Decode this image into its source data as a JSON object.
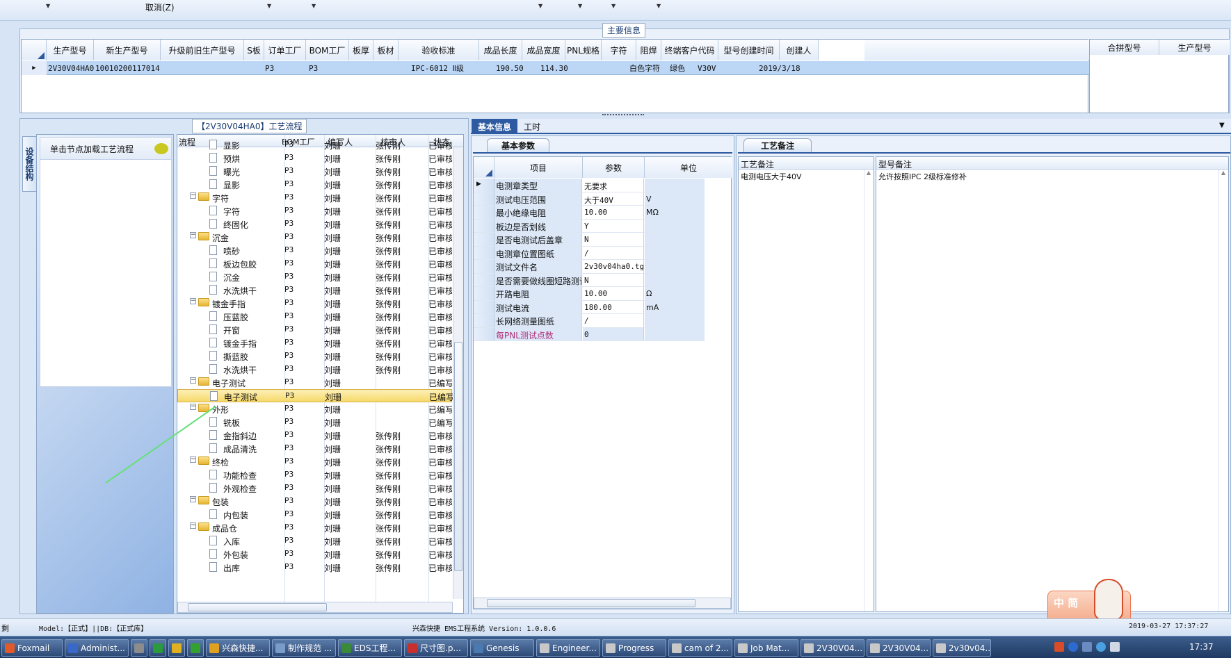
{
  "toolbar": {
    "cancel_label": "取消(Z)"
  },
  "main_info": {
    "group_title": "主要信息",
    "columns": [
      "生产型号",
      "新生产型号",
      "升级前旧生产型号",
      "S板",
      "订单工厂",
      "BOM工厂",
      "板厚",
      "板材",
      "验收标准",
      "成品长度",
      "成品宽度",
      "PNL规格",
      "字符",
      "阻焊",
      "终端客户代码",
      "型号创建时间",
      "创建人"
    ],
    "row": {
      "prod_no": "2V30V04HA0",
      "new_prod_no": "10010200117014",
      "order_factory": "P3",
      "bom_factory": "P3",
      "standard": "IPC-6012 Ⅱ级",
      "length": "190.50",
      "width": "114.30",
      "char": "白色字符",
      "solder_mask": "绿色",
      "customer_code": "V30V",
      "created": "2019/3/18"
    },
    "right_columns": [
      "合拼型号",
      "生产型号"
    ]
  },
  "flow": {
    "group_title": "【2V30V04HA0】工艺流程",
    "side_tab": "设备结构",
    "load_hint": "单击节点加载工艺流程",
    "columns": [
      "流程",
      "BOM工厂",
      "编写人",
      "核审人",
      "状态"
    ],
    "rows": [
      {
        "level": 2,
        "type": "doc",
        "name": "显影",
        "bom": "P3",
        "writer": "刘珊",
        "reviewer": "张传刚",
        "status": "已审核"
      },
      {
        "level": 2,
        "type": "doc",
        "name": "预烘",
        "bom": "P3",
        "writer": "刘珊",
        "reviewer": "张传刚",
        "status": "已审核"
      },
      {
        "level": 2,
        "type": "doc",
        "name": "曝光",
        "bom": "P3",
        "writer": "刘珊",
        "reviewer": "张传刚",
        "status": "已审核"
      },
      {
        "level": 2,
        "type": "doc",
        "name": "显影",
        "bom": "P3",
        "writer": "刘珊",
        "reviewer": "张传刚",
        "status": "已审核"
      },
      {
        "level": 1,
        "type": "folder",
        "name": "字符",
        "bom": "P3",
        "writer": "刘珊",
        "reviewer": "张传刚",
        "status": "已审核"
      },
      {
        "level": 2,
        "type": "doc",
        "name": "字符",
        "bom": "P3",
        "writer": "刘珊",
        "reviewer": "张传刚",
        "status": "已审核"
      },
      {
        "level": 2,
        "type": "doc",
        "name": "终固化",
        "bom": "P3",
        "writer": "刘珊",
        "reviewer": "张传刚",
        "status": "已审核"
      },
      {
        "level": 1,
        "type": "folder",
        "name": "沉金",
        "bom": "P3",
        "writer": "刘珊",
        "reviewer": "张传刚",
        "status": "已审核"
      },
      {
        "level": 2,
        "type": "doc",
        "name": "喷砂",
        "bom": "P3",
        "writer": "刘珊",
        "reviewer": "张传刚",
        "status": "已审核"
      },
      {
        "level": 2,
        "type": "doc",
        "name": "板边包胶",
        "bom": "P3",
        "writer": "刘珊",
        "reviewer": "张传刚",
        "status": "已审核"
      },
      {
        "level": 2,
        "type": "doc",
        "name": "沉金",
        "bom": "P3",
        "writer": "刘珊",
        "reviewer": "张传刚",
        "status": "已审核"
      },
      {
        "level": 2,
        "type": "doc",
        "name": "水洗烘干",
        "bom": "P3",
        "writer": "刘珊",
        "reviewer": "张传刚",
        "status": "已审核"
      },
      {
        "level": 1,
        "type": "folder",
        "name": "镀金手指",
        "bom": "P3",
        "writer": "刘珊",
        "reviewer": "张传刚",
        "status": "已审核"
      },
      {
        "level": 2,
        "type": "doc",
        "name": "压蓝胶",
        "bom": "P3",
        "writer": "刘珊",
        "reviewer": "张传刚",
        "status": "已审核"
      },
      {
        "level": 2,
        "type": "doc",
        "name": "开窗",
        "bom": "P3",
        "writer": "刘珊",
        "reviewer": "张传刚",
        "status": "已审核"
      },
      {
        "level": 2,
        "type": "doc",
        "name": "镀金手指",
        "bom": "P3",
        "writer": "刘珊",
        "reviewer": "张传刚",
        "status": "已审核"
      },
      {
        "level": 2,
        "type": "doc",
        "name": "撕蓝胶",
        "bom": "P3",
        "writer": "刘珊",
        "reviewer": "张传刚",
        "status": "已审核"
      },
      {
        "level": 2,
        "type": "doc",
        "name": "水洗烘干",
        "bom": "P3",
        "writer": "刘珊",
        "reviewer": "张传刚",
        "status": "已审核"
      },
      {
        "level": 1,
        "type": "folder",
        "name": "电子测试",
        "bom": "P3",
        "writer": "刘珊",
        "reviewer": "",
        "status": "已编写"
      },
      {
        "level": 2,
        "type": "doc",
        "name": "电子测试",
        "bom": "P3",
        "writer": "刘珊",
        "reviewer": "",
        "status": "已编写",
        "selected": true
      },
      {
        "level": 1,
        "type": "folder",
        "name": "外形",
        "bom": "P3",
        "writer": "刘珊",
        "reviewer": "",
        "status": "已编写"
      },
      {
        "level": 2,
        "type": "doc",
        "name": "铣板",
        "bom": "P3",
        "writer": "刘珊",
        "reviewer": "",
        "status": "已编写"
      },
      {
        "level": 2,
        "type": "doc",
        "name": "金指斜边",
        "bom": "P3",
        "writer": "刘珊",
        "reviewer": "张传刚",
        "status": "已审核"
      },
      {
        "level": 2,
        "type": "doc",
        "name": "成品清洗",
        "bom": "P3",
        "writer": "刘珊",
        "reviewer": "张传刚",
        "status": "已审核"
      },
      {
        "level": 1,
        "type": "folder",
        "name": "终检",
        "bom": "P3",
        "writer": "刘珊",
        "reviewer": "张传刚",
        "status": "已审核"
      },
      {
        "level": 2,
        "type": "doc",
        "name": "功能检查",
        "bom": "P3",
        "writer": "刘珊",
        "reviewer": "张传刚",
        "status": "已审核"
      },
      {
        "level": 2,
        "type": "doc",
        "name": "外观检查",
        "bom": "P3",
        "writer": "刘珊",
        "reviewer": "张传刚",
        "status": "已审核"
      },
      {
        "level": 1,
        "type": "folder",
        "name": "包装",
        "bom": "P3",
        "writer": "刘珊",
        "reviewer": "张传刚",
        "status": "已审核"
      },
      {
        "level": 2,
        "type": "doc",
        "name": "内包装",
        "bom": "P3",
        "writer": "刘珊",
        "reviewer": "张传刚",
        "status": "已审核"
      },
      {
        "level": 1,
        "type": "folder",
        "name": "成品仓",
        "bom": "P3",
        "writer": "刘珊",
        "reviewer": "张传刚",
        "status": "已审核"
      },
      {
        "level": 2,
        "type": "doc",
        "name": "入库",
        "bom": "P3",
        "writer": "刘珊",
        "reviewer": "张传刚",
        "status": "已审核"
      },
      {
        "level": 2,
        "type": "doc",
        "name": "外包装",
        "bom": "P3",
        "writer": "刘珊",
        "reviewer": "张传刚",
        "status": "已审核"
      },
      {
        "level": 2,
        "type": "doc",
        "name": "出库",
        "bom": "P3",
        "writer": "刘珊",
        "reviewer": "张传刚",
        "status": "已审核"
      }
    ]
  },
  "tabs": {
    "basic_info": "基本信息",
    "operations": "工时"
  },
  "params": {
    "tab_label": "基本参数",
    "columns": [
      "项目",
      "参数",
      "单位"
    ],
    "rows": [
      {
        "item": "电测章类型",
        "value": "无要求",
        "unit": ""
      },
      {
        "item": "测试电压范围",
        "value": "大于40V",
        "unit": "V"
      },
      {
        "item": "最小绝缘电阻",
        "value": "10.00",
        "unit": "MΩ"
      },
      {
        "item": "板边是否划线",
        "value": "Y",
        "unit": ""
      },
      {
        "item": "是否电测试后盖章",
        "value": "N",
        "unit": ""
      },
      {
        "item": "电测章位置图纸",
        "value": "/",
        "unit": ""
      },
      {
        "item": "测试文件名",
        "value": "2v30v04ha0.tgz",
        "unit": ""
      },
      {
        "item": "是否需要做线圈短路测试",
        "value": "N",
        "unit": ""
      },
      {
        "item": "开路电阻",
        "value": "10.00",
        "unit": "Ω"
      },
      {
        "item": "测试电流",
        "value": "180.00",
        "unit": "mA"
      },
      {
        "item": "长网络测量图纸",
        "value": "/",
        "unit": ""
      },
      {
        "item": "每PNL测试点数",
        "value": "0",
        "unit": "",
        "highlight_color": "#b0307a"
      }
    ]
  },
  "notes": {
    "tab_label": "工艺备注",
    "process_note_label": "工艺备注",
    "model_note_label": "型号备注",
    "process_note": "电测电压大于40V",
    "model_note": "允许按照IPC 2级标准修补"
  },
  "status_bar": {
    "left": "剩",
    "model": "Model:【正式】||DB:【正式库】",
    "system": "兴森快捷 EMS工程系统 Version: 1.0.0.6",
    "datetime": "2019-03-27 17:37:27"
  },
  "ime": {
    "label": "中 简"
  },
  "taskbar": {
    "items": [
      "Foxmail",
      "Administ...",
      "",
      "",
      "",
      "",
      "兴森快捷...",
      "制作规范 ...",
      "EDS工程...",
      "尺寸图.p...",
      "Genesis",
      "Engineer...",
      "Progress",
      "cam of 2...",
      "Job Mat...",
      "2V30V04...",
      "2V30V04...",
      "2v30v04..."
    ],
    "clock": "17:37"
  }
}
